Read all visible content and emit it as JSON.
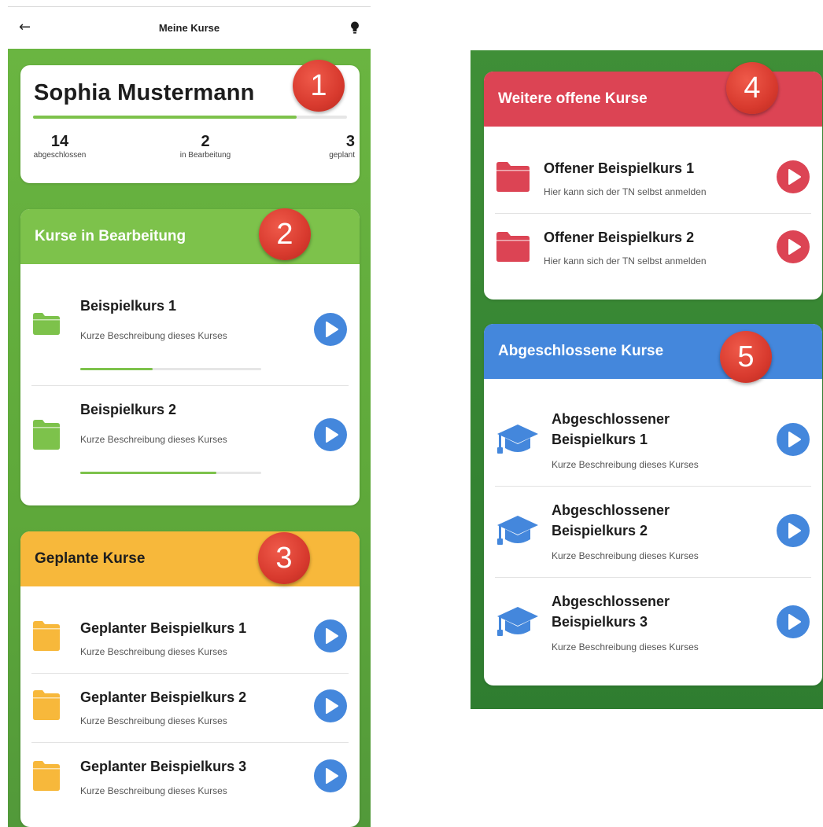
{
  "appbar": {
    "title": "Meine Kurse",
    "back_icon": "arrow-left-icon",
    "help_icon": "lightbulb-icon"
  },
  "profile": {
    "name": "Sophia Mustermann",
    "progress": 0.84,
    "stats": [
      {
        "value": "14",
        "label": "abgeschlossen"
      },
      {
        "value": "2",
        "label": "in Bearbeitung"
      },
      {
        "value": "3",
        "label": "geplant"
      }
    ]
  },
  "in_progress": {
    "title": "Kurse in Bearbeitung",
    "items": [
      {
        "title": "Beispielkurs 1",
        "desc": "Kurze Beschreibung dieses Kurses",
        "progress": 0.4
      },
      {
        "title": "Beispielkurs 2",
        "desc": "Kurze Beschreibung dieses Kurses",
        "progress": 0.75
      }
    ]
  },
  "planned": {
    "title": "Geplante Kurse",
    "items": [
      {
        "title": "Geplanter Beispielkurs 1",
        "desc": "Kurze Beschreibung dieses Kurses"
      },
      {
        "title": "Geplanter Beispielkurs 2",
        "desc": "Kurze Beschreibung dieses Kurses"
      },
      {
        "title": "Geplanter Beispielkurs 3",
        "desc": "Kurze Beschreibung dieses Kurses"
      }
    ]
  },
  "open_courses": {
    "title": "Weitere offene Kurse",
    "items": [
      {
        "title": "Offener Beispielkurs 1",
        "desc": "Hier kann sich der TN selbst anmelden"
      },
      {
        "title": "Offener Beispielkurs 2",
        "desc": "Hier kann sich der TN selbst anmelden"
      }
    ]
  },
  "completed": {
    "title": "Abgeschlossene Kurse",
    "items": [
      {
        "title_line1": "Abgeschlossener",
        "title_line2": "Beispielkurs 1",
        "desc": "Kurze Beschreibung dieses Kurses"
      },
      {
        "title_line1": "Abgeschlossener",
        "title_line2": "Beispielkurs 2",
        "desc": "Kurze Beschreibung dieses Kurses"
      },
      {
        "title_line1": "Abgeschlossener",
        "title_line2": "Beispielkurs 3",
        "desc": "Kurze Beschreibung dieses Kurses"
      }
    ]
  },
  "badges": [
    "1",
    "2",
    "3",
    "4",
    "5"
  ],
  "colors": {
    "green": "#7dc24b",
    "yellow": "#f7b83b",
    "red": "#dc4454",
    "blue": "#4487dc",
    "badge": "#d83a2e"
  }
}
